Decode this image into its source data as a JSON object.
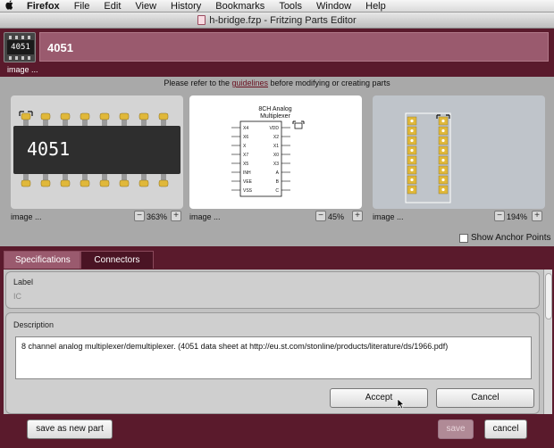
{
  "menubar": {
    "app": "Firefox",
    "items": [
      "File",
      "Edit",
      "View",
      "History",
      "Bookmarks",
      "Tools",
      "Window",
      "Help"
    ]
  },
  "window": {
    "title": "h-bridge.fzp - Fritzing Parts Editor"
  },
  "header": {
    "part_title": "4051",
    "icon_chip_text": "4051",
    "icon_label": "image ..."
  },
  "guidelines": {
    "prefix": "Please refer to the ",
    "link": "guidelines",
    "suffix": " before modifying or creating parts"
  },
  "views": {
    "breadboard": {
      "chip_text": "4051",
      "image_label": "image ...",
      "zoom": "363%",
      "minus": "−",
      "plus": "+"
    },
    "schematic": {
      "title_line1": "8CH Analog",
      "title_line2": "Multiplexer",
      "left_pins": [
        "X4",
        "X6",
        "X",
        "X7",
        "X5",
        "INH",
        "VEE",
        "VSS"
      ],
      "right_pins": [
        "VDD",
        "X2",
        "X1",
        "X0",
        "X3",
        "A",
        "B",
        "C"
      ],
      "image_label": "image ...",
      "zoom": "45%",
      "minus": "−",
      "plus": "+"
    },
    "pcb": {
      "image_label": "image ...",
      "zoom": "194%",
      "minus": "−",
      "plus": "+"
    }
  },
  "anchor_points": {
    "label": "Show Anchor Points",
    "checked": false
  },
  "tabs": [
    "Specifications",
    "Connectors"
  ],
  "specifications": {
    "label_heading": "Label",
    "label_value": "IC",
    "description_heading": "Description",
    "description_value": "8 channel analog multiplexer/demultiplexer. (4051 data sheet at http://eu.st.com/stonline/products/literature/ds/1966.pdf)",
    "accept": "Accept",
    "cancel": "Cancel"
  },
  "footer": {
    "save_as_new": "save as new part",
    "save": "save",
    "cancel": "cancel"
  },
  "colors": {
    "frame": "#5a1a2c",
    "title_field": "#9a5a6e",
    "gold_pad": "#e0b83a"
  }
}
